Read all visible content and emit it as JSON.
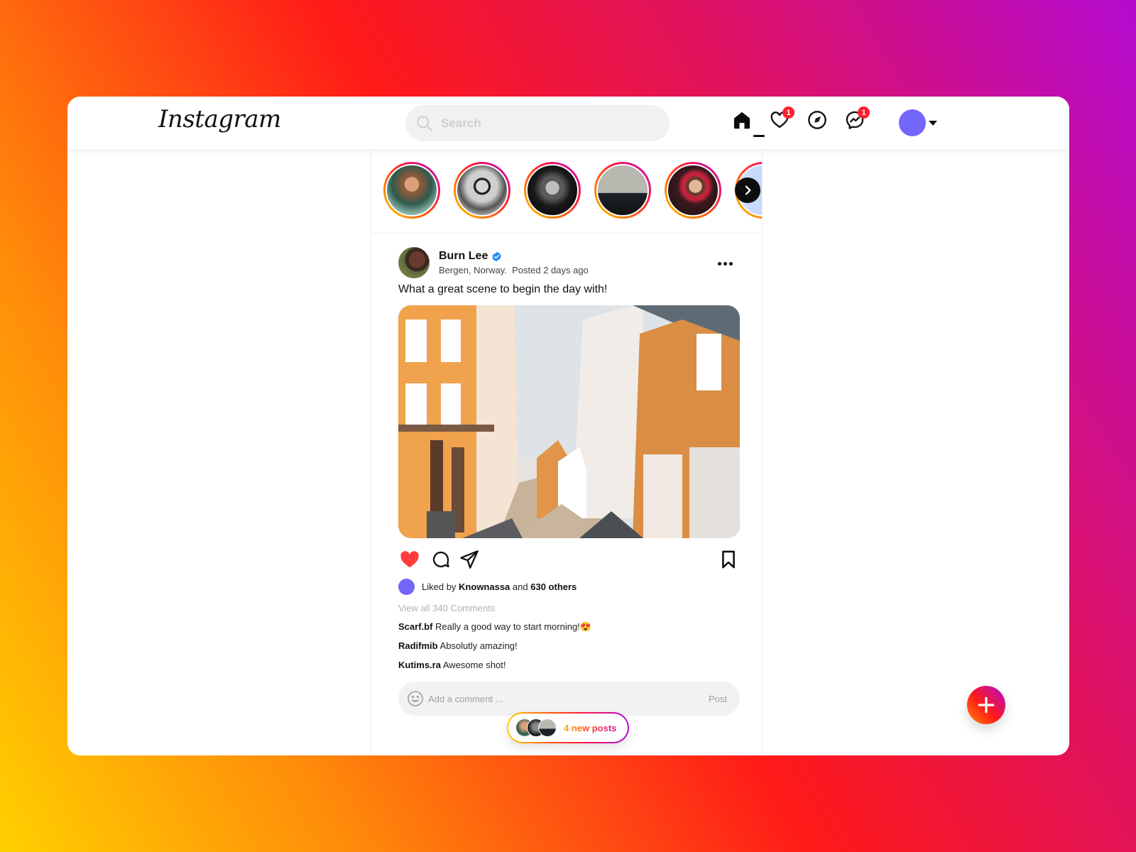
{
  "header": {
    "logo": "Instagram",
    "search_placeholder": "Search",
    "nav": [
      {
        "name": "home",
        "icon": "home-icon",
        "active": true
      },
      {
        "name": "activity",
        "icon": "heart-icon",
        "badge": "1"
      },
      {
        "name": "explore",
        "icon": "compass-icon"
      },
      {
        "name": "messages",
        "icon": "messenger-icon",
        "badge": "1"
      }
    ],
    "profile_color": "#7566fb"
  },
  "stories": [
    {
      "name": "story-1"
    },
    {
      "name": "story-2"
    },
    {
      "name": "story-3"
    },
    {
      "name": "story-4"
    },
    {
      "name": "story-5"
    },
    {
      "name": "story-6"
    }
  ],
  "post": {
    "username": "Burn Lee",
    "verified": true,
    "location": "Bergen, Norway.",
    "posted": "Posted 2 days ago",
    "caption": "What a great scene to begin the day with!",
    "image_alt": "Colorful street in Bergen with orange and white wooden houses",
    "liked": true,
    "likes": {
      "prefix": "Liked by",
      "user": "Knownassa",
      "middle": "and",
      "others": "630 others"
    },
    "view_all_comments": "View all 340 Comments",
    "comments": [
      {
        "user": "Scarf.bf",
        "text": "Really a good way to start morning!",
        "emoji": "😍"
      },
      {
        "user": "Radifmib",
        "text": "Absolutly amazing!"
      },
      {
        "user": "Kutims.ra",
        "text": "Awesome shot!"
      }
    ],
    "comment_placeholder": "Add a comment ...",
    "post_button": "Post"
  },
  "new_posts": {
    "label": "4 new posts"
  },
  "fab": {
    "icon": "plus-icon"
  },
  "colors": {
    "accent_purple": "#7566fb",
    "badge_red": "#ff1e2d",
    "like_red": "#ff3b3b",
    "verified_blue": "#1d8cf8"
  }
}
